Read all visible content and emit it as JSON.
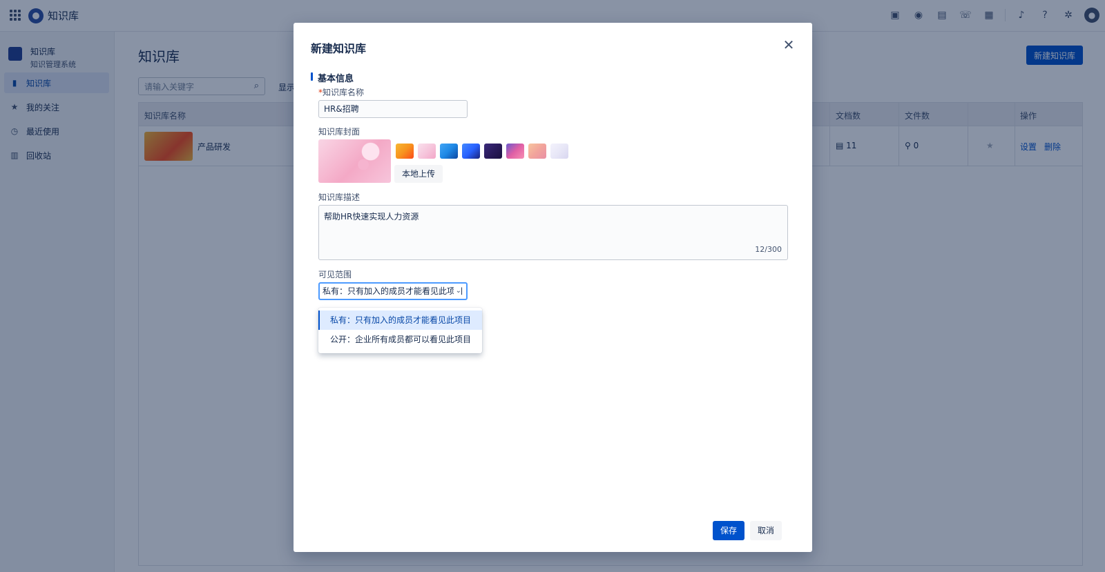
{
  "app": {
    "title": "知识库"
  },
  "topbar": {
    "icons": [
      "calendar-check-icon",
      "user-icon",
      "document-icon",
      "phone-icon",
      "calendar-icon",
      "bell-icon",
      "help-icon",
      "gear-icon",
      "avatar-icon"
    ]
  },
  "sidebar": {
    "header": {
      "title": "知识库",
      "subtitle": "知识管理系统"
    },
    "items": [
      {
        "label": "知识库",
        "icon": "book-icon",
        "active": true
      },
      {
        "label": "我的关注",
        "icon": "star-icon",
        "active": false
      },
      {
        "label": "最近使用",
        "icon": "clock-icon",
        "active": false
      },
      {
        "label": "回收站",
        "icon": "trash-icon",
        "active": false
      }
    ]
  },
  "main": {
    "title": "知识库",
    "new_button": "新建知识库",
    "search_placeholder": "请输入关键字",
    "show_label": "显示",
    "table": {
      "headers": {
        "name": "知识库名称",
        "docs": "文档数",
        "files": "文件数",
        "ops": "操作"
      },
      "rows": [
        {
          "name": "产品研发",
          "docs": "11",
          "files": "0",
          "op_settings": "设置",
          "op_delete": "删除"
        }
      ]
    }
  },
  "modal": {
    "title": "新建知识库",
    "section_title": "基本信息",
    "name_label": "知识库名称",
    "name_required_mark": "*",
    "name_value": "HR&招聘",
    "cover_label": "知识库封面",
    "upload_button": "本地上传",
    "desc_label": "知识库描述",
    "desc_value": "帮助HR快速实现人力资源",
    "desc_count": "12/300",
    "visibility_label": "可见范围",
    "visibility_value": "私有：只有加入的成员才能看见此项目",
    "visibility_options": [
      {
        "label": "私有：只有加入的成员才能看见此项目",
        "selected": true
      },
      {
        "label": "公开：企业所有成员都可以看见此项目",
        "selected": false
      }
    ],
    "save_button": "保存",
    "cancel_button": "取消"
  },
  "colors": {
    "primary": "#0052cc",
    "overlay": "rgba(9,30,66,0.48)",
    "swatches": [
      "#f7931e",
      "#f6c6dc",
      "#1e88e5",
      "#2962ff",
      "#2a1b5c",
      "#e05fa5",
      "#f2a49b",
      "#e8e7f7"
    ]
  }
}
